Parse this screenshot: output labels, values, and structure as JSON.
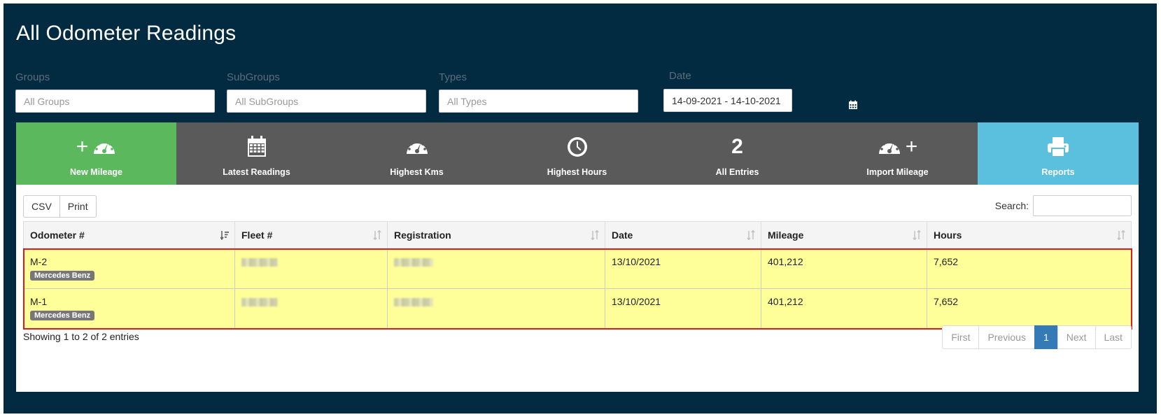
{
  "page": {
    "title": "All Odometer Readings"
  },
  "filters": {
    "groups": {
      "label": "Groups",
      "placeholder": "All Groups"
    },
    "subgroups": {
      "label": "SubGroups",
      "placeholder": "All SubGroups"
    },
    "types": {
      "label": "Types",
      "placeholder": "All Types"
    },
    "date": {
      "label": "Date",
      "value": "14-09-2021 - 14-10-2021"
    }
  },
  "tiles": {
    "new_mileage": "New Mileage",
    "latest_readings": "Latest Readings",
    "highest_kms": "Highest Kms",
    "highest_hours": "Highest Hours",
    "all_entries": "All Entries",
    "all_entries_count": "2",
    "import_mileage": "Import Mileage",
    "reports": "Reports"
  },
  "toolbar": {
    "csv": "CSV",
    "print": "Print",
    "search_label": "Search:"
  },
  "table": {
    "columns": [
      "Odometer #",
      "Fleet #",
      "Registration",
      "Date",
      "Mileage",
      "Hours"
    ],
    "rows": [
      {
        "odometer": "M-2",
        "make": "Mercedes Benz",
        "date": "13/10/2021",
        "mileage": "401,212",
        "hours": "7,652"
      },
      {
        "odometer": "M-1",
        "make": "Mercedes Benz",
        "date": "13/10/2021",
        "mileage": "401,212",
        "hours": "7,652"
      }
    ]
  },
  "footer": {
    "info": "Showing 1 to 2 of 2 entries",
    "pager": {
      "first": "First",
      "previous": "Previous",
      "current": "1",
      "next": "Next",
      "last": "Last"
    }
  },
  "colors": {
    "frame": "#022a40",
    "green": "#5cb85c",
    "gray": "#5a5a5a",
    "blue": "#5bc0de",
    "row_highlight": "#ffff99",
    "selection_border": "#e01b1b",
    "pager_active": "#337ab7"
  }
}
